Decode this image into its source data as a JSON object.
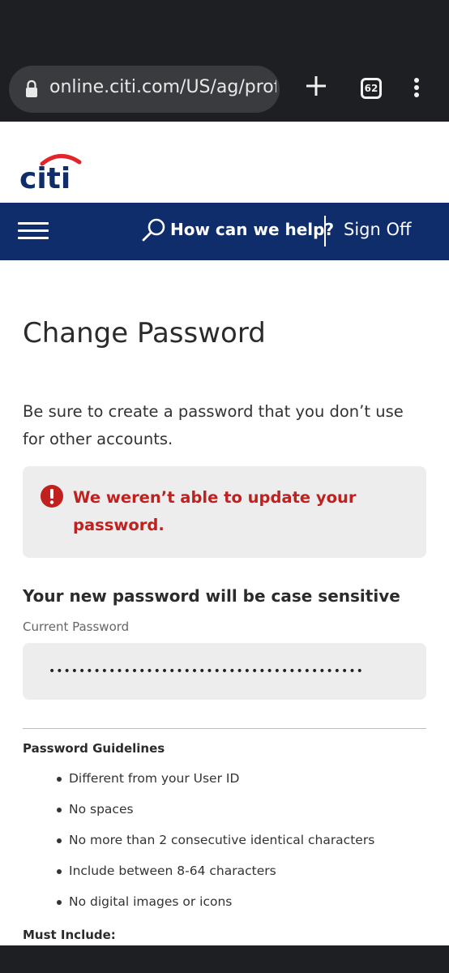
{
  "browser": {
    "url": "online.citi.com/US/ag/profi",
    "tab_count": "62",
    "icons": [
      "lock-icon",
      "plus-icon",
      "tabs-icon",
      "more-vert-icon"
    ]
  },
  "brand": {
    "logo_text": "citi",
    "logo_color": "#0f2c6b",
    "arc_color": "#e3242b"
  },
  "nav": {
    "search_label": "How can we help?",
    "signoff_label": "Sign Off",
    "background": "#0f2c6b"
  },
  "page": {
    "title": "Change Password",
    "intro": "Be sure to create a password that you don’t use for other accounts.",
    "alert": {
      "message": "We weren’t able to update your password.",
      "color": "#c0211f"
    },
    "section_heading": "Your new password will be case sensitive",
    "current_password": {
      "label": "Current Password",
      "value": "••••••••••••••••••••••••••••••••••••••••••"
    },
    "guidelines": {
      "title": "Password Guidelines",
      "items": [
        "Different from your User ID",
        "No spaces",
        "No more than 2 consecutive identical characters",
        "Include between 8-64 characters",
        "No digital images or icons"
      ]
    },
    "must_include_title": "Must Include:"
  }
}
